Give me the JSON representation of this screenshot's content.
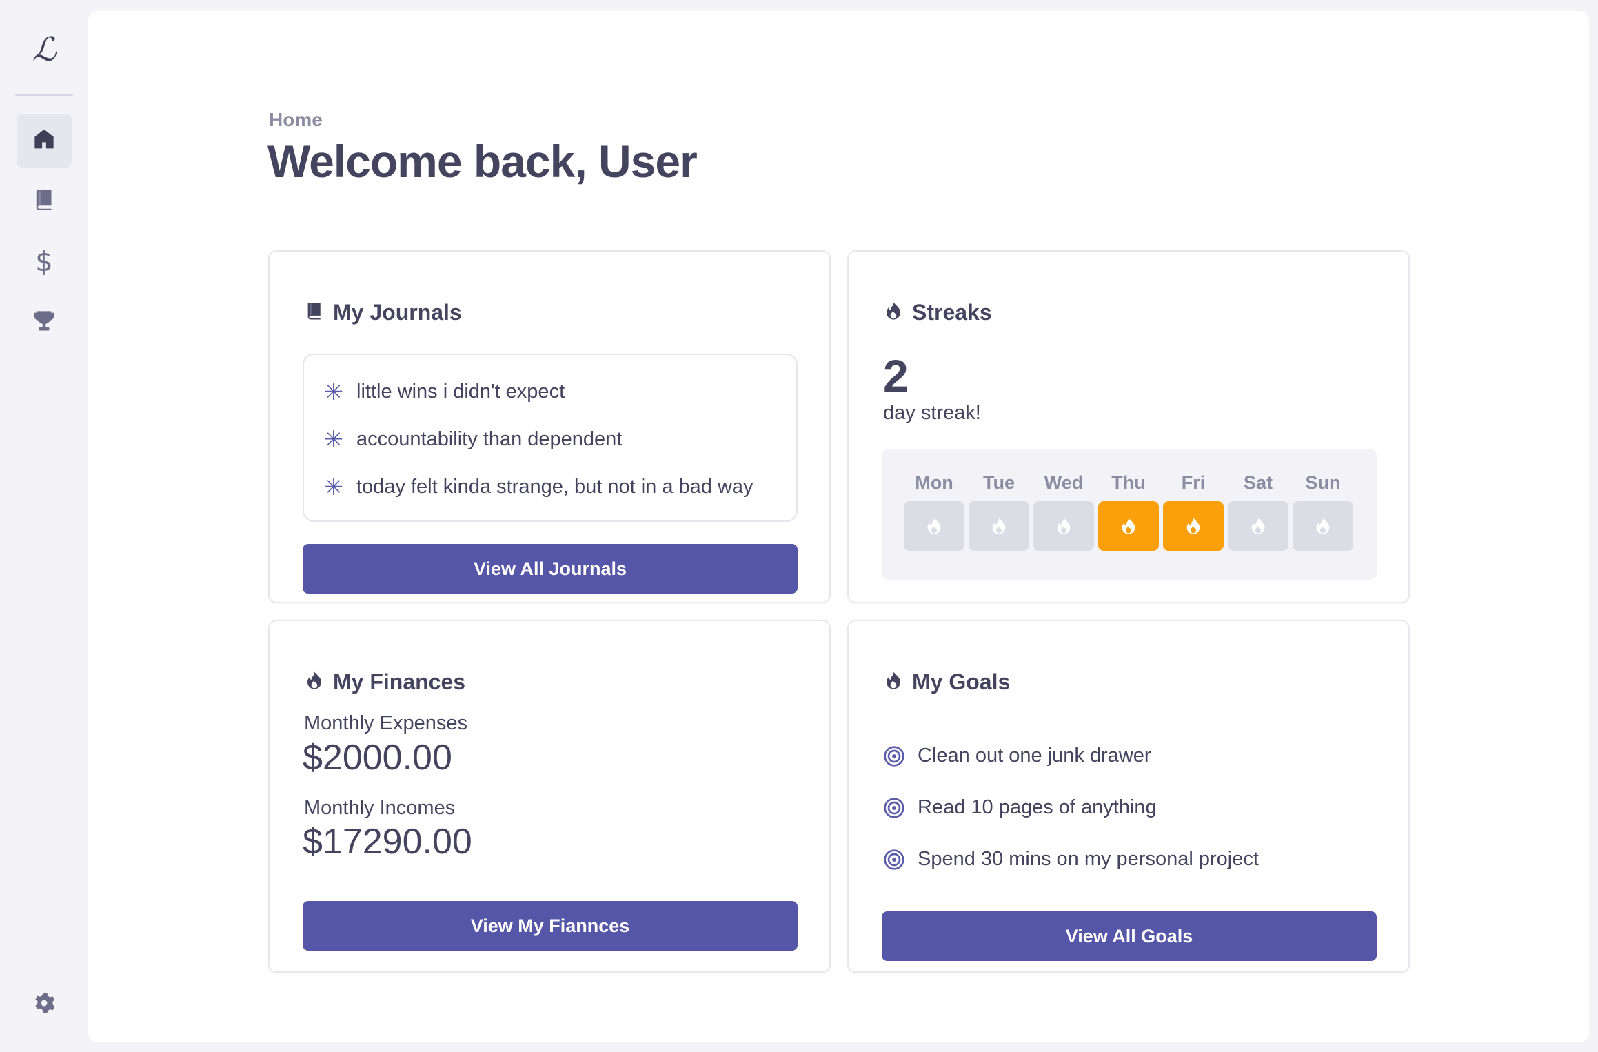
{
  "sidebar": {
    "logo": "ℒ",
    "nav": [
      {
        "name": "home",
        "icon": "home-icon",
        "active": true
      },
      {
        "name": "journals",
        "icon": "book-icon",
        "active": false
      },
      {
        "name": "finances",
        "icon": "dollar-icon",
        "active": false
      },
      {
        "name": "goals",
        "icon": "trophy-icon",
        "active": false
      }
    ],
    "settings_icon": "gear-icon",
    "dollar_glyph": "$"
  },
  "header": {
    "breadcrumb": "Home",
    "title": "Welcome back, User"
  },
  "journals": {
    "title": "My Journals",
    "icon": "book-icon",
    "entries": [
      "little wins i didn't expect",
      "accountability than dependent",
      "today felt kinda strange, but not in a bad way"
    ],
    "button_label": "View All Journals"
  },
  "streaks": {
    "title": "Streaks",
    "icon": "flame-icon",
    "count": "2",
    "label": "day streak!",
    "days": [
      {
        "label": "Mon",
        "active": false
      },
      {
        "label": "Tue",
        "active": false
      },
      {
        "label": "Wed",
        "active": false
      },
      {
        "label": "Thu",
        "active": true
      },
      {
        "label": "Fri",
        "active": true
      },
      {
        "label": "Sat",
        "active": false
      },
      {
        "label": "Sun",
        "active": false
      }
    ]
  },
  "finances": {
    "title": "My Finances",
    "icon": "flame-icon",
    "expenses_label": "Monthly Expenses",
    "expenses_value": "$2000.00",
    "incomes_label": "Monthly Incomes",
    "incomes_value": "$17290.00",
    "button_label": "View My Fiannces"
  },
  "goals": {
    "title": "My Goals",
    "icon": "flame-icon",
    "items": [
      "Clean out one junk drawer",
      "Read 10 pages of anything",
      "Spend 30 mins on my personal project"
    ],
    "button_label": "View All Goals"
  },
  "colors": {
    "accent": "#5556a8",
    "streak_on": "#fb9f0a",
    "streak_off": "#dcdce4",
    "text": "#44445e",
    "muted": "#8b8ba2"
  }
}
